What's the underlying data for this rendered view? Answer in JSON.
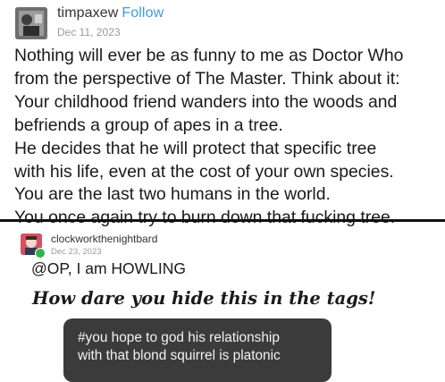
{
  "post1": {
    "username": "timpaxew",
    "follow_label": "Follow",
    "date": "Dec 11, 2023",
    "lines": [
      "Nothing will ever be as funny to me as Doctor Who",
      "from the perspective of The Master. Think about it:",
      "Your childhood friend wanders into the woods and",
      "befriends a group of apes in a tree.",
      "He decides that he will protect that specific tree",
      "with his life, even at the cost of your own species.",
      "You are the last two humans in the world.",
      "You once again try to burn down that fucking tree."
    ]
  },
  "post2": {
    "username": "clockworkthenightbard",
    "date": "Dec 23, 2023",
    "reply": "@OP, I am HOWLING",
    "highlight": "How dare you hide this in the tags!",
    "tag_lines": [
      "#you hope to god his relationship",
      "with that blond squirrel is platonic"
    ]
  },
  "colors": {
    "follow": "#3a9de0",
    "tag_background": "#3b3b3b",
    "online_indicator": "#34b24a"
  }
}
